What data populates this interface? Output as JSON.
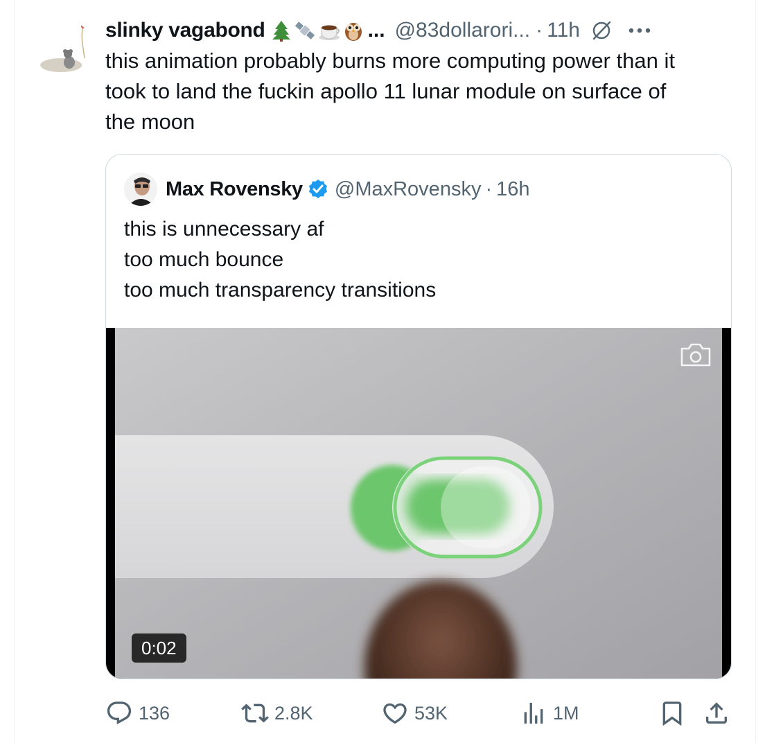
{
  "tweet": {
    "author_name": "slinky vagabond",
    "name_emojis": [
      "tree-emoji",
      "satellite-emoji",
      "coffee-emoji",
      "owl-emoji"
    ],
    "name_ellipsis": "...",
    "handle": "@83dollarori...",
    "time": "11h",
    "text": "this animation probably burns more computing power than it\ntook to land the fuckin apollo 11 lunar module on surface of\nthe moon"
  },
  "quoted": {
    "author_name": "Max Rovensky",
    "handle": "@MaxRovensky",
    "time": "16h",
    "text": "this is unnecessary af\ntoo much bounce\ntoo much transparency transitions",
    "video": {
      "timestamp": "0:02"
    }
  },
  "actions": {
    "replies": "136",
    "reposts": "2.8K",
    "likes": "53K",
    "views": "1M"
  },
  "colors": {
    "text": "#0f1419",
    "muted": "#536471",
    "verified": "#1d9bf0",
    "toggle_green": "#6cc66c",
    "border": "#cfd9de"
  }
}
